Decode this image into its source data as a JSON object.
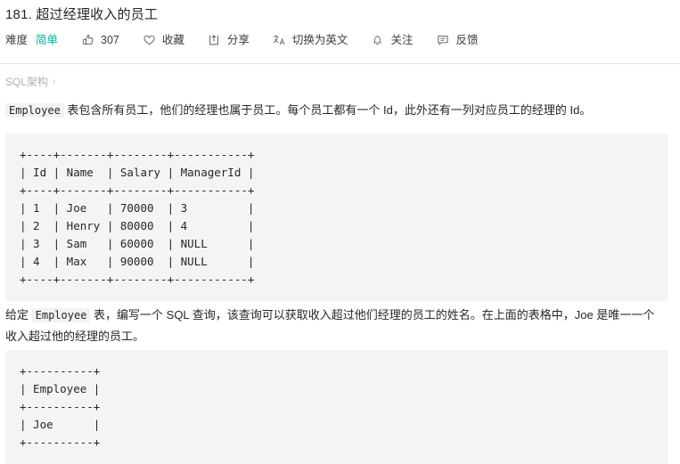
{
  "header": {
    "title": "181. 超过经理收入的员工"
  },
  "toolbar": {
    "difficulty_label": "难度",
    "difficulty_value": "简单",
    "difficulty_color": "#00af9b",
    "like": {
      "icon": "thumbs-up-icon",
      "count": "307"
    },
    "favorite": {
      "icon": "heart-icon",
      "label": "收藏"
    },
    "share": {
      "icon": "share-icon",
      "label": "分享"
    },
    "translate": {
      "icon": "translate-icon",
      "label": "切换为英文"
    },
    "subscribe": {
      "icon": "bell-icon",
      "label": "关注"
    },
    "feedback": {
      "icon": "comment-icon",
      "label": "反馈"
    }
  },
  "breadcrumb": {
    "label": "SQL架构",
    "chevron": "›"
  },
  "content": {
    "paragraph_1": {
      "code": "Employee",
      "text": " 表包含所有员工，他们的经理也属于员工。每个员工都有一个 Id，此外还有一列对应员工的经理的 Id。"
    },
    "paragraph_2": {
      "prefix": "给定 ",
      "code": "Employee",
      "text": " 表，编写一个 SQL 查询，该查询可以获取收入超过他们经理的员工的姓名。在上面的表格中，Joe 是唯一一个收入超过他的经理的员工。"
    },
    "code_block_1": "+----+-------+--------+-----------+\n| Id | Name  | Salary | ManagerId |\n+----+-------+--------+-----------+\n| 1  | Joe   | 70000  | 3         |\n| 2  | Henry | 80000  | 4         |\n| 3  | Sam   | 60000  | NULL      |\n| 4  | Max   | 90000  | NULL      |\n+----+-------+--------+-----------+",
    "code_block_2": "+----------+\n| Employee |\n+----------+\n| Joe      |\n+----------+"
  },
  "table_data": {
    "columns": [
      "Id",
      "Name",
      "Salary",
      "ManagerId"
    ],
    "rows": [
      [
        "1",
        "Joe",
        "70000",
        "3"
      ],
      [
        "2",
        "Henry",
        "80000",
        "4"
      ],
      [
        "3",
        "Sam",
        "60000",
        "NULL"
      ],
      [
        "4",
        "Max",
        "90000",
        "NULL"
      ]
    ]
  },
  "result_data": {
    "columns": [
      "Employee"
    ],
    "rows": [
      [
        "Joe"
      ]
    ]
  }
}
